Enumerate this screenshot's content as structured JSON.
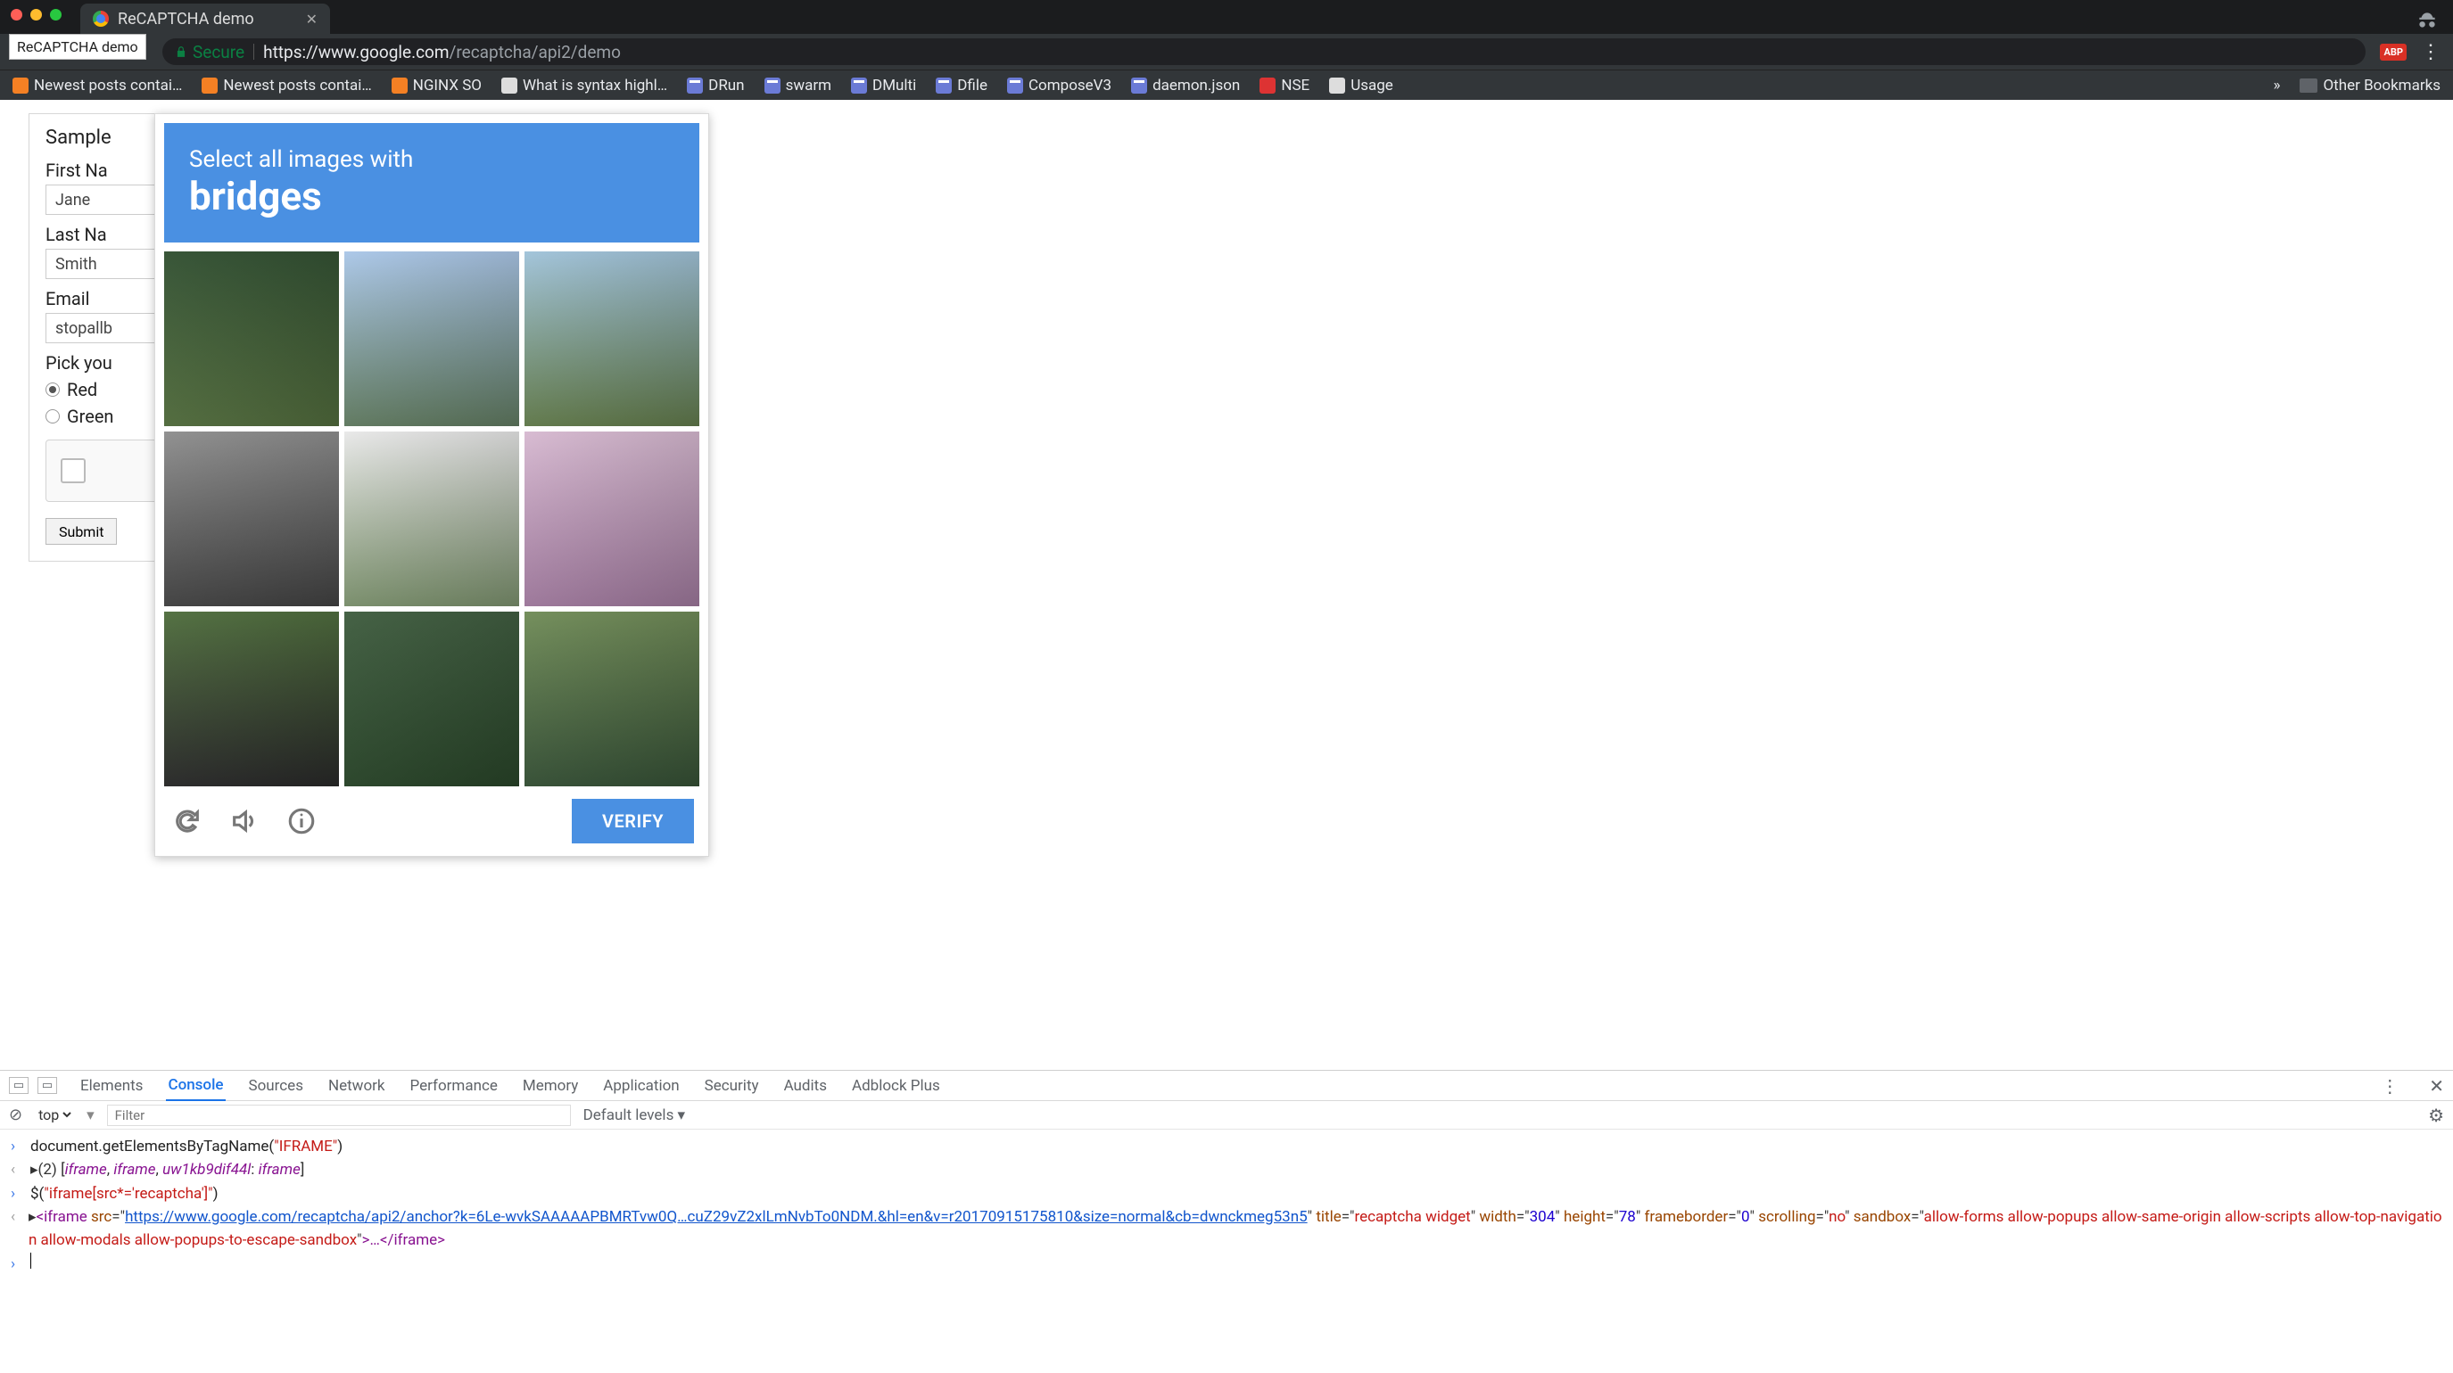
{
  "window": {
    "tab_title": "ReCAPTCHA demo",
    "tab_tooltip": "ReCAPTCHA demo"
  },
  "toolbar": {
    "secure_label": "Secure",
    "url_host": "https://www.google.com",
    "url_path": "/recaptcha/api2/demo",
    "ext_badge": "ABP"
  },
  "bookmarks": {
    "items": [
      "Newest posts contai…",
      "Newest posts contai…",
      "NGINX SO",
      "What is syntax highl…",
      "DRun",
      "swarm",
      "DMulti",
      "Dfile",
      "ComposeV3",
      "daemon.json",
      "NSE",
      "Usage"
    ],
    "overflow": "»",
    "other_label": "Other Bookmarks"
  },
  "form": {
    "heading": "Sample",
    "first_name_label": "First Na",
    "first_name_value": "Jane",
    "last_name_label": "Last Na",
    "last_name_value": "Smith",
    "email_label": "Email",
    "email_value": "stopallb",
    "pick_label": "Pick you",
    "radio_red": "Red",
    "radio_green": "Green",
    "submit_label": "Submit"
  },
  "captcha": {
    "line1": "Select all images with",
    "line2": "bridges",
    "verify_label": "VERIFY"
  },
  "devtools": {
    "tabs": [
      "Elements",
      "Console",
      "Sources",
      "Network",
      "Performance",
      "Memory",
      "Application",
      "Security",
      "Audits",
      "Adblock Plus"
    ],
    "active_tab": "Console",
    "context": "top",
    "filter_placeholder": "Filter",
    "levels_label": "Default levels ▾",
    "lines": {
      "l1_code": "document.getElementsByTagName(",
      "l1_str": "\"IFRAME\"",
      "l1_code_end": ")",
      "l2_prefix": "(2) ",
      "l2_body_open": "[",
      "l2_iframe": "iframe",
      "l2_key": "uw1kb9dif44l",
      "l2_body_close": "]",
      "l3_code": "$(",
      "l3_str": "\"iframe[src*='recaptcha']\"",
      "l3_code_end": ")",
      "l4_tag_open": "<iframe",
      "l4_attr_src": "src",
      "l4_url": "https://www.google.com/recaptcha/api2/anchor?k=6Le-wvkSAAAAAPBMRTvw0Q…cuZ29vZ2xlLmNvbTo0NDM.&hl=en&v=r20170915175810&size=normal&cb=dwnckmeg53n5",
      "l4_attr_title": "title",
      "l4_title_val": "recaptcha widget",
      "l4_attr_width": "width",
      "l4_width_val": "304",
      "l4_attr_height": "height",
      "l4_height_val": "78",
      "l4_attr_fb": "frameborder",
      "l4_fb_val": "0",
      "l4_attr_scroll": "scrolling",
      "l4_scroll_val": "no",
      "l4_attr_sandbox": "sandbox",
      "l4_sandbox_val": "allow-forms allow-popups allow-same-origin allow-scripts allow-top-navigation allow-modals allow-popups-to-escape-sandbox",
      "l4_tag_close": ">…</iframe>"
    }
  }
}
